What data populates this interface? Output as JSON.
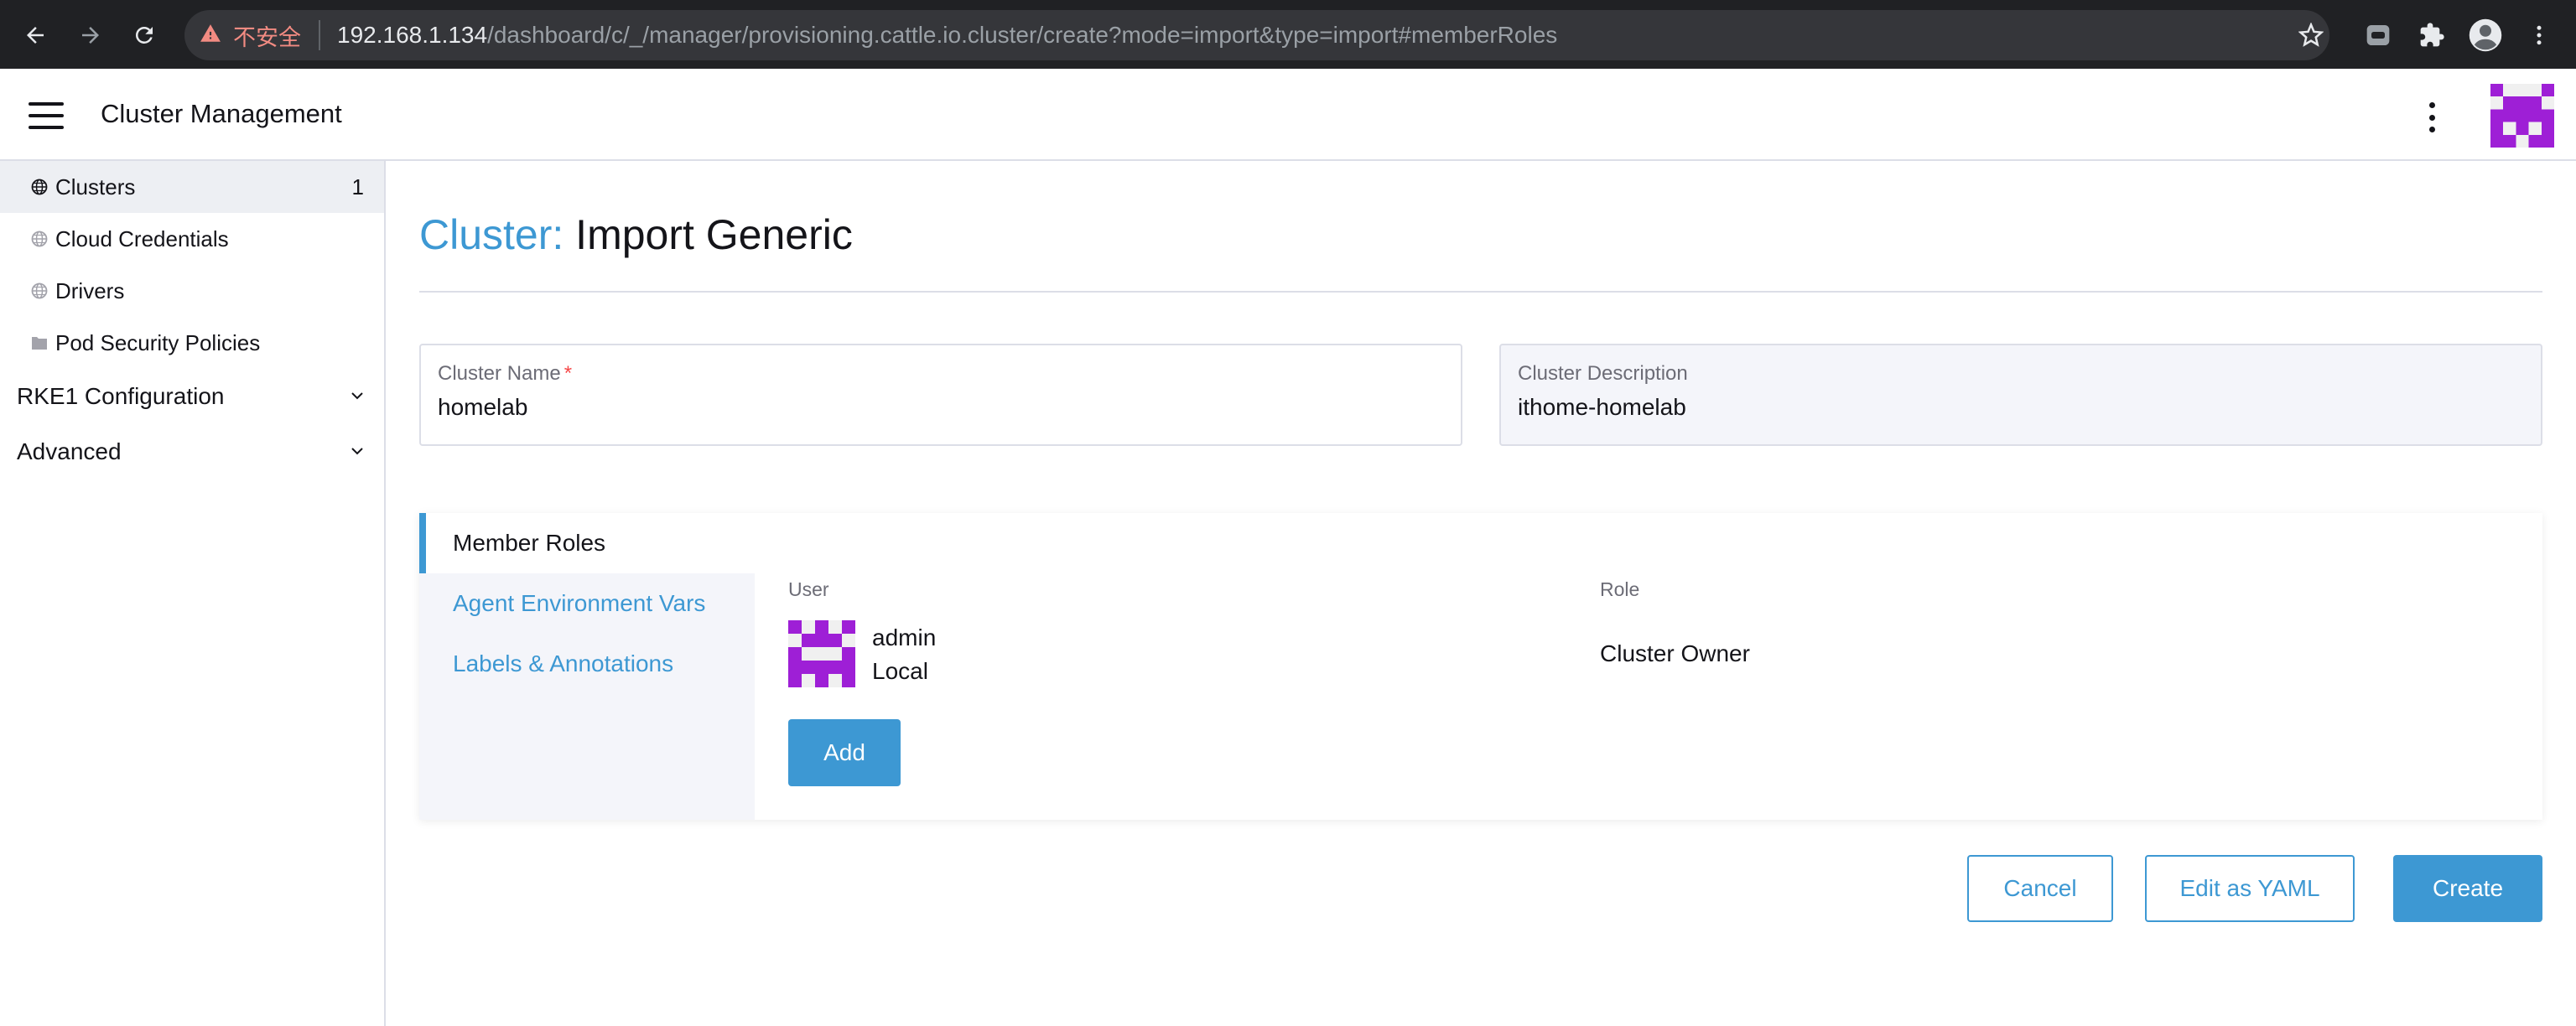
{
  "browser": {
    "security_text": "不安全",
    "url_host": "192.168.1.134",
    "url_path": "/dashboard/c/_/manager/provisioning.cattle.io.cluster/create?mode=import&type=import#memberRoles",
    "icons": [
      "back-arrow-icon",
      "forward-arrow-icon",
      "reload-icon",
      "warning-icon",
      "star-icon",
      "line-extension-icon",
      "puzzle-icon",
      "profile-icon",
      "more-vert-icon"
    ]
  },
  "header": {
    "title": "Cluster Management"
  },
  "sidebar": {
    "items": [
      {
        "label": "Clusters",
        "count": "1",
        "icon": "globe-icon",
        "active": true
      },
      {
        "label": "Cloud Credentials",
        "icon": "globe-icon"
      },
      {
        "label": "Drivers",
        "icon": "globe-icon"
      },
      {
        "label": "Pod Security Policies",
        "icon": "folder-icon"
      }
    ],
    "groups": [
      {
        "label": "RKE1 Configuration"
      },
      {
        "label": "Advanced"
      }
    ]
  },
  "page": {
    "title_prefix": "Cluster:",
    "title_name": "Import Generic"
  },
  "form": {
    "cluster_name": {
      "label": "Cluster Name",
      "required_mark": "*",
      "value": "homelab"
    },
    "cluster_description": {
      "label": "Cluster Description",
      "value": "ithome-homelab"
    }
  },
  "tabs": [
    {
      "label": "Member Roles",
      "active": true
    },
    {
      "label": "Agent Environment Vars"
    },
    {
      "label": "Labels & Annotations"
    }
  ],
  "members": {
    "columns": {
      "user": "User",
      "role": "Role"
    },
    "rows": [
      {
        "name": "admin",
        "source": "Local",
        "role": "Cluster Owner"
      }
    ],
    "add_label": "Add"
  },
  "footer": {
    "cancel_label": "Cancel",
    "yaml_label": "Edit as YAML",
    "create_label": "Create"
  },
  "colors": {
    "accent": "#3d98d3",
    "avatar": "#9e1fd6",
    "chrome_bg": "#202124",
    "required": "#f64747"
  }
}
